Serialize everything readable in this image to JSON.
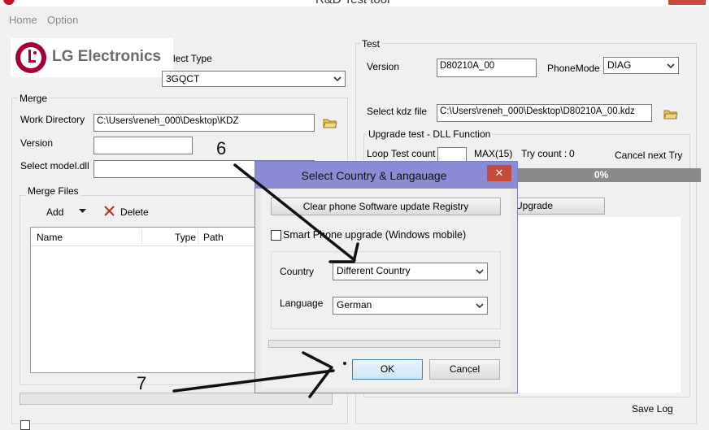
{
  "window": {
    "title": "R&D Test tool"
  },
  "menu": {
    "items": [
      "Home",
      "Option"
    ]
  },
  "logo": {
    "text": "LG Electronics"
  },
  "select_type": {
    "label": "lect Type",
    "value": "3GQCT"
  },
  "merge": {
    "title": "Merge",
    "work_directory_label": "Work Directory",
    "work_directory_value": "C:\\Users\\reneh_000\\Desktop\\KDZ",
    "version_label": "Version",
    "version_value": "",
    "select_model_label": "Select model.dll",
    "merge_files_title": "Merge Files",
    "add_label": "Add",
    "delete_label": "Delete",
    "columns": [
      "Name",
      "Type",
      "Path"
    ]
  },
  "test": {
    "title": "Test",
    "version_label": "Version",
    "version_value": "D80210A_00",
    "phonemode_label": "PhoneMode",
    "phonemode_value": "DIAG",
    "kdz_label": "Select kdz file",
    "kdz_value": "C:\\Users\\reneh_000\\Desktop\\D80210A_00.kdz",
    "upgrade_title": "Upgrade test - DLL Function",
    "loop_label": "Loop Test count",
    "max_label": "MAX(15)",
    "try_count_label": "Try count :",
    "try_count_value": "0",
    "cancel_next_label": "Cancel next Try",
    "progress_text": "0%",
    "progress_fraction": 0,
    "upgrade_button": "Upgrade",
    "save_log": "Save Log"
  },
  "dialog": {
    "title": "Select Country & Langauage",
    "clear_button": "Clear phone Software update Registry",
    "smart_phone_label": "Smart Phone upgrade (Windows mobile)",
    "country_label": "Country",
    "country_value": "Different Country",
    "language_label": "Language",
    "language_value": "German",
    "ok_button": "OK",
    "cancel_button": "Cancel",
    "close_glyph": "✕"
  },
  "annotations": {
    "step6": "6",
    "step7": "7"
  },
  "colors": {
    "dialog_border": "#8c8cd6",
    "close_red": "#c74a3a",
    "progress_gray": "#8a8a8a",
    "lg_red": "#a50034"
  }
}
